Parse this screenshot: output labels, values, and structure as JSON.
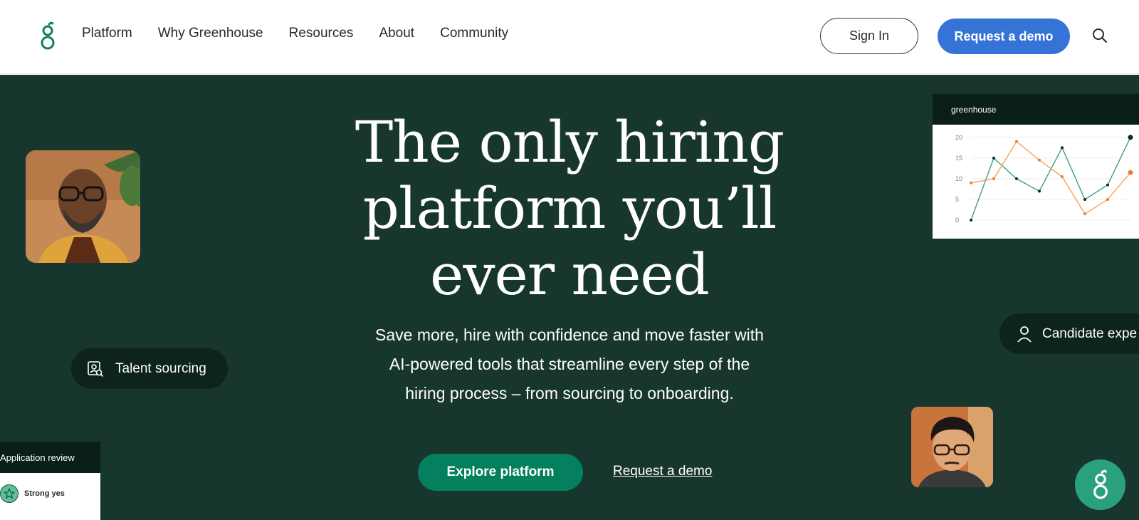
{
  "nav": {
    "logo": "greenhouse-logo",
    "links": [
      "Platform",
      "Why Greenhouse",
      "Resources",
      "About",
      "Community"
    ],
    "signin_label": "Sign In",
    "demo_label": "Request a demo",
    "search_icon": "search-icon"
  },
  "hero": {
    "headline_lines": [
      "The only hiring",
      "platform you’ll",
      "ever need"
    ],
    "sub_lines": [
      "Save more, hire with confidence and move faster with",
      "AI-powered tools that streamline every step of the",
      "hiring process – from sourcing to onboarding."
    ],
    "explore_label": "Explore platform",
    "demo_link_label": "Request a demo"
  },
  "pills": {
    "talent": "Talent sourcing",
    "candidate": "Candidate expe"
  },
  "chart_card": {
    "brand": "greenhouse"
  },
  "review_card": {
    "title": "Application review",
    "rating": "Strong yes"
  },
  "colors": {
    "hero_bg": "#17362e",
    "primary_blue": "#3574d6",
    "explore_green": "#04805e",
    "chat_green": "#2aa07f",
    "line_green": "#3ea07c",
    "line_orange": "#f3a35c"
  },
  "chart_data": {
    "type": "line",
    "yticks": [
      "0",
      "5",
      "10",
      "15",
      "20"
    ],
    "ylim": [
      0,
      21
    ],
    "x": [
      0,
      1,
      2,
      3,
      4,
      5,
      6,
      7
    ],
    "series": [
      {
        "values": [
          0,
          15,
          10,
          7,
          17.5,
          5,
          8.5,
          20
        ]
      },
      {
        "values": [
          9,
          10,
          19,
          14.5,
          10.5,
          1.5,
          5,
          11.5
        ]
      }
    ]
  }
}
